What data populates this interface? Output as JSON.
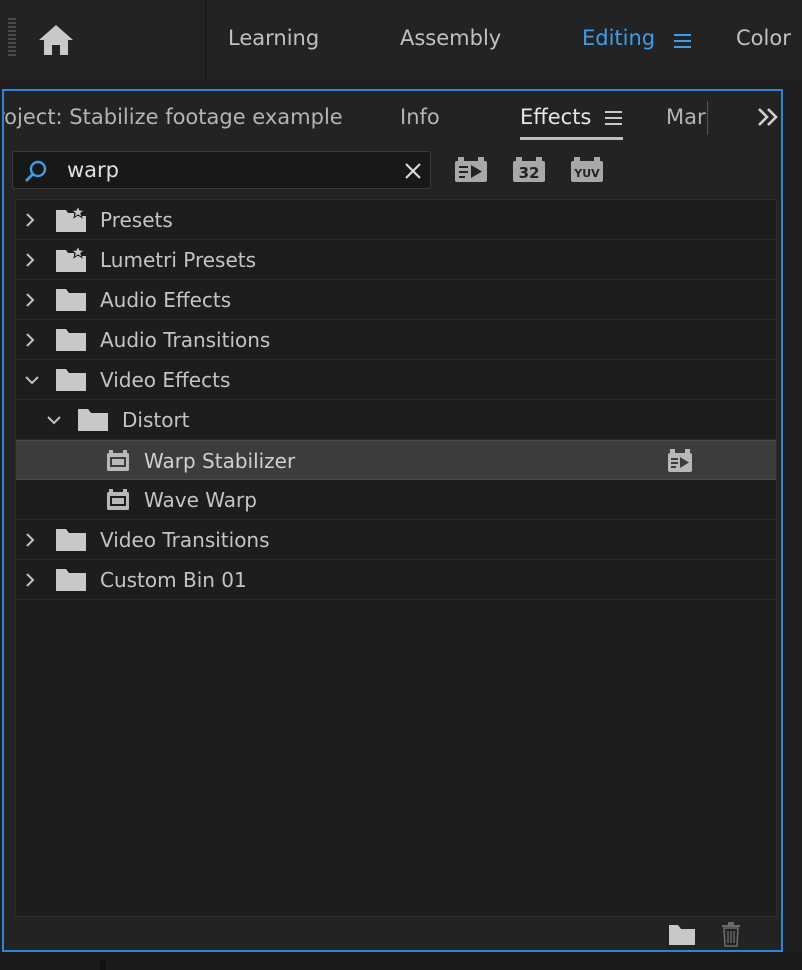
{
  "workspaces": {
    "tabs": [
      {
        "label": "Learning",
        "active": false
      },
      {
        "label": "Assembly",
        "active": false
      },
      {
        "label": "Editing",
        "active": true
      },
      {
        "label": "Color",
        "active": false
      }
    ]
  },
  "panel": {
    "tabs": [
      {
        "label": "roject: Stabilize footage example",
        "active": false
      },
      {
        "label": "Info",
        "active": false
      },
      {
        "label": "Effects",
        "active": true
      },
      {
        "label": "Mar",
        "active": false
      }
    ]
  },
  "search": {
    "value": "warp",
    "placeholder": ""
  },
  "filters": {
    "accelerated_label": "",
    "bit32_label": "32",
    "yuv_label": "YUV"
  },
  "tree": {
    "items": [
      {
        "label": "Presets",
        "level": 0,
        "expanded": false,
        "icon": "preset-folder-icon"
      },
      {
        "label": "Lumetri Presets",
        "level": 0,
        "expanded": false,
        "icon": "preset-folder-icon"
      },
      {
        "label": "Audio Effects",
        "level": 0,
        "expanded": false,
        "icon": "folder-icon"
      },
      {
        "label": "Audio Transitions",
        "level": 0,
        "expanded": false,
        "icon": "folder-icon"
      },
      {
        "label": "Video Effects",
        "level": 0,
        "expanded": true,
        "icon": "folder-icon"
      },
      {
        "label": "Distort",
        "level": 1,
        "expanded": true,
        "icon": "folder-icon"
      },
      {
        "label": "Warp Stabilizer",
        "level": 2,
        "selected": true,
        "icon": "effect-icon",
        "accelerated": true
      },
      {
        "label": "Wave Warp",
        "level": 2,
        "selected": false,
        "icon": "effect-icon",
        "accelerated": false
      },
      {
        "label": "Video Transitions",
        "level": 0,
        "expanded": false,
        "icon": "folder-icon"
      },
      {
        "label": "Custom Bin 01",
        "level": 0,
        "expanded": false,
        "icon": "folder-icon"
      }
    ]
  },
  "colors": {
    "accent": "#3c9ee8",
    "panel_border": "#2e84d6",
    "background": "#232323"
  }
}
